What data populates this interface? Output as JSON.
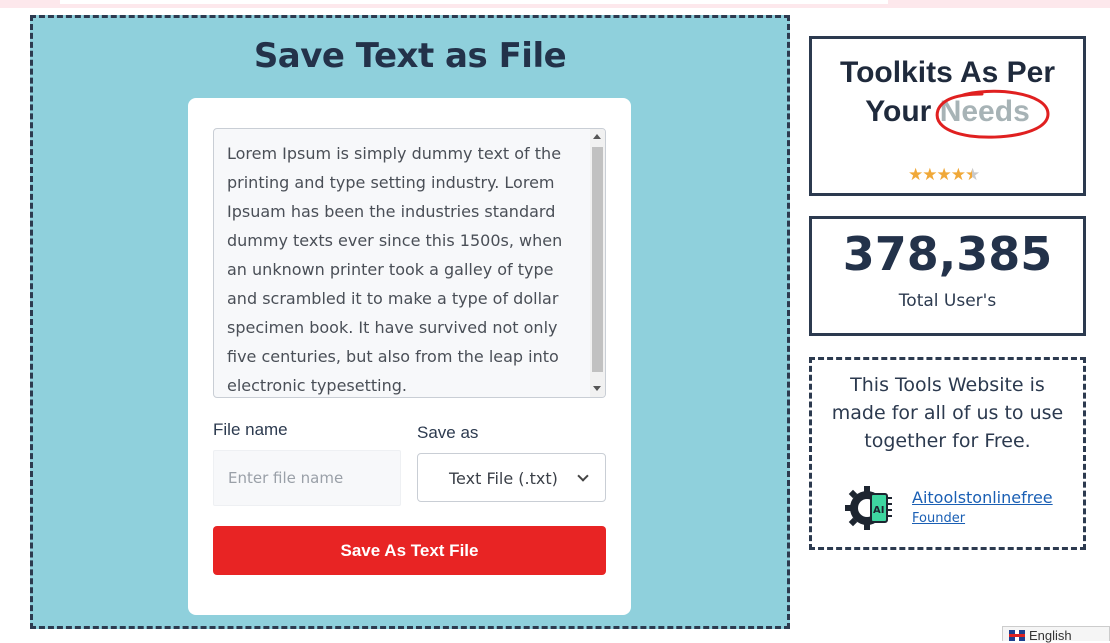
{
  "page": {
    "title": "Save Text as File"
  },
  "editor": {
    "text": "Lorem Ipsum is simply dummy text of the printing and type setting industry. Lorem Ipsuam has been the industries standard dummy texts ever since this 1500s, when an unknown printer took a galley of type and scrambled it to make a type of dollar specimen book. It have survived not only five centuries, but also from the leap into electronic typesetting."
  },
  "form": {
    "filename_label": "File name",
    "filename_placeholder": "Enter file name",
    "filename_value": "",
    "saveas_label": "Save as",
    "saveas_selected": "Text File (.txt)",
    "save_button": "Save As Text File"
  },
  "sidebar": {
    "toolkit_line1": "Toolkits As Per",
    "toolkit_your": "Your",
    "toolkit_needs": "Needs",
    "rating": 4.5,
    "users_count": "378,385",
    "users_label": "Total User's",
    "about_text": "This Tools Website is made for all of us to use together for Free.",
    "founder_name": "Aitoolstonlinefree",
    "founder_role": "Founder",
    "founder_logo_text": "AI"
  },
  "language": {
    "label": "English",
    "flag": "uk-flag-icon"
  },
  "colors": {
    "panel_bg": "#8fd0dc",
    "button_red": "#e82424",
    "dark_text": "#23324a",
    "accent_circle": "#e02020",
    "star": "#f0a838",
    "link": "#1a5fb4"
  }
}
